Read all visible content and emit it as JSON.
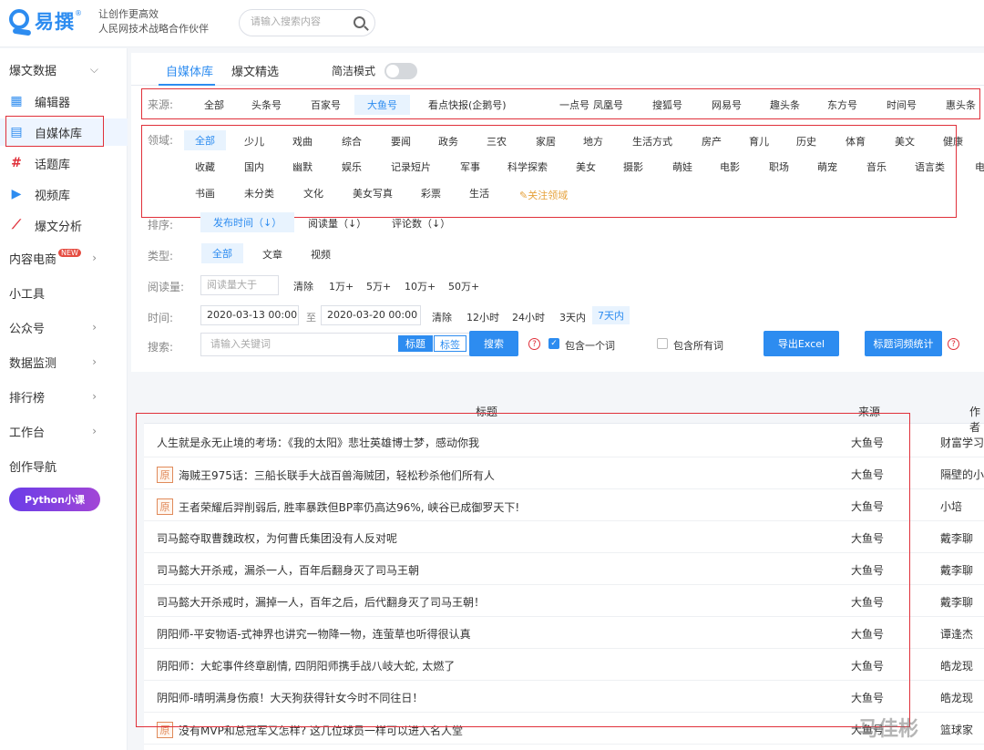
{
  "header": {
    "logo_text": "易撰",
    "logo_reg": "®",
    "slogan_line1": "让创作更高效",
    "slogan_line2": "人民网技术战略合作伙伴",
    "search_placeholder": "请输入搜索内容"
  },
  "sidebar": {
    "top_group": "爆文数据",
    "items": [
      {
        "label": "编辑器",
        "icon": "grid-icon"
      },
      {
        "label": "自媒体库",
        "icon": "doc-icon"
      },
      {
        "label": "话题库",
        "icon": "hash-icon"
      },
      {
        "label": "视频库",
        "icon": "video-icon"
      },
      {
        "label": "爆文分析",
        "icon": "chart-icon"
      }
    ],
    "groups": [
      "内容电商",
      "小工具",
      "公众号",
      "数据监测",
      "排行榜",
      "工作台",
      "创作导航"
    ],
    "new_badge": "NEW",
    "python_badge": "Python小课"
  },
  "tabs": {
    "media_lib": "自媒体库",
    "hot_picks": "爆文精选",
    "simple_mode": "简洁模式"
  },
  "filters": {
    "source_label": "来源:",
    "sources": [
      "全部",
      "头条号",
      "百家号",
      "大鱼号",
      "看点快报(企鹅号)",
      "一点号",
      "凤凰号",
      "搜狐号",
      "网易号",
      "趣头条",
      "东方号",
      "时间号",
      "惠头条"
    ],
    "source_selected": "大鱼号",
    "domain_label": "领域:",
    "domains_row1": [
      "全部",
      "少儿",
      "戏曲",
      "综合",
      "要闻",
      "政务",
      "三农",
      "家居",
      "地方",
      "生活方式",
      "房产",
      "育儿",
      "历史",
      "体育",
      "美文",
      "健康"
    ],
    "domains_row2": [
      "收藏",
      "国内",
      "幽默",
      "娱乐",
      "记录短片",
      "军事",
      "科学探索",
      "美女",
      "摄影",
      "萌娃",
      "电影",
      "职场",
      "萌宠",
      "音乐",
      "语言类",
      "电"
    ],
    "domains_row3": [
      "书画",
      "未分类",
      "文化",
      "美女写真",
      "彩票",
      "生活"
    ],
    "follow_domain": "关注领域",
    "sort_label": "排序:",
    "sorts": [
      "发布时间（↓）",
      "阅读量（↓）",
      "评论数（↓）"
    ],
    "type_label": "类型:",
    "types": [
      "全部",
      "文章",
      "视频"
    ],
    "read_label": "阅读量:",
    "read_placeholder": "阅读量大于",
    "read_options": [
      "清除",
      "1万+",
      "5万+",
      "10万+",
      "50万+"
    ],
    "time_label": "时间:",
    "time_from": "2020-03-13 00:00",
    "time_to_sep": "至",
    "time_to": "2020-03-20 00:00",
    "time_options": [
      "清除",
      "12小时",
      "24小时",
      "3天内",
      "7天内"
    ],
    "search_label": "搜索:",
    "keyword_placeholder": "请输入关键词",
    "mode_title": "标题",
    "mode_tag": "标签",
    "search_btn": "搜索",
    "include_one": "包含一个词",
    "include_all": "包含所有词",
    "export_btn": "导出Excel",
    "stats_btn": "标题词频统计"
  },
  "table": {
    "headers": {
      "title": "标题",
      "source": "来源",
      "author": "作者"
    },
    "rows": [
      {
        "title": "人生就是永无止境的考场：《我的太阳》悲壮英雄博士梦，感动你我",
        "orig": false,
        "source": "大鱼号",
        "author": "财富学习"
      },
      {
        "title": "海贼王975话：三船长联手大战百兽海贼团，轻松秒杀他们所有人",
        "orig": true,
        "source": "大鱼号",
        "author": "隔壁的小"
      },
      {
        "title": "王者荣耀后羿削弱后, 胜率暴跌但BP率仍高达96%, 峡谷已成御罗天下!",
        "orig": true,
        "source": "大鱼号",
        "author": "小培"
      },
      {
        "title": "司马懿夺取曹魏政权，为何曹氏集团没有人反对呢",
        "orig": false,
        "source": "大鱼号",
        "author": "戴李聊"
      },
      {
        "title": "司马懿大开杀戒，漏杀一人，百年后翻身灭了司马王朝",
        "orig": false,
        "source": "大鱼号",
        "author": "戴李聊"
      },
      {
        "title": "司马懿大开杀戒时，漏掉一人，百年之后，后代翻身灭了司马王朝！",
        "orig": false,
        "source": "大鱼号",
        "author": "戴李聊"
      },
      {
        "title": "阴阳师-平安物语-式神界也讲究一物降一物，连萤草也听得很认真",
        "orig": false,
        "source": "大鱼号",
        "author": "谭逢杰"
      },
      {
        "title": "阴阳师：大蛇事件终章剧情, 四阴阳师携手战八岐大蛇, 太燃了",
        "orig": false,
        "source": "大鱼号",
        "author": "皓龙现"
      },
      {
        "title": "阴阳师-晴明满身伤痕！大天狗获得针女今时不同往日！",
        "orig": false,
        "source": "大鱼号",
        "author": "皓龙现"
      },
      {
        "title": "没有MVP和总冠军又怎样? 这几位球员一样可以进入名人堂",
        "orig": true,
        "source": "大鱼号",
        "author": "篮球家"
      }
    ],
    "orig_mark": "原"
  },
  "watermark": "马佳彬"
}
